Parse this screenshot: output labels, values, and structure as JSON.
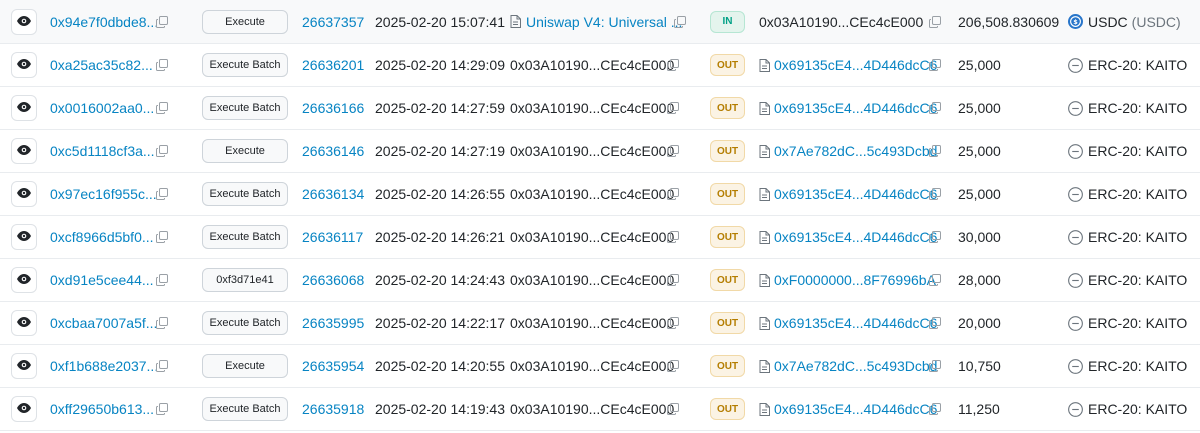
{
  "colors": {
    "link": "#0784c3",
    "in": "#00a186",
    "out": "#b47d00",
    "text": "#212529"
  },
  "rows": [
    {
      "hash": "0x94e7f0dbde8...",
      "method": "Execute",
      "block": "26637357",
      "age": "2025-02-20 15:07:41",
      "from": "Uniswap V4: Universal ...",
      "from_is_link": true,
      "direction": "IN",
      "to": "0x03A10190...CEc4cE000",
      "to_is_link": false,
      "amount": "206,508.830609",
      "token_name": "USDC",
      "token_symbol": "(USDC)",
      "token_icon": "usdc-icon"
    },
    {
      "hash": "0xa25ac35c82...",
      "method": "Execute Batch",
      "block": "26636201",
      "age": "2025-02-20 14:29:09",
      "from": "0x03A10190...CEc4cE000",
      "from_is_link": false,
      "direction": "OUT",
      "to": "0x69135cE4...4D446dcC6",
      "to_is_link": true,
      "amount": "25,000",
      "token_name": "ERC-20: KAITO",
      "token_symbol": "",
      "token_icon": "erc20-token-icon"
    },
    {
      "hash": "0x0016002aa0...",
      "method": "Execute Batch",
      "block": "26636166",
      "age": "2025-02-20 14:27:59",
      "from": "0x03A10190...CEc4cE000",
      "from_is_link": false,
      "direction": "OUT",
      "to": "0x69135cE4...4D446dcC6",
      "to_is_link": true,
      "amount": "25,000",
      "token_name": "ERC-20: KAITO",
      "token_symbol": "",
      "token_icon": "erc20-token-icon"
    },
    {
      "hash": "0xc5d1118cf3a...",
      "method": "Execute",
      "block": "26636146",
      "age": "2025-02-20 14:27:19",
      "from": "0x03A10190...CEc4cE000",
      "from_is_link": false,
      "direction": "OUT",
      "to": "0x7Ae782dC...5c493Dcbd",
      "to_is_link": true,
      "amount": "25,000",
      "token_name": "ERC-20: KAITO",
      "token_symbol": "",
      "token_icon": "erc20-token-icon"
    },
    {
      "hash": "0x97ec16f955c...",
      "method": "Execute Batch",
      "block": "26636134",
      "age": "2025-02-20 14:26:55",
      "from": "0x03A10190...CEc4cE000",
      "from_is_link": false,
      "direction": "OUT",
      "to": "0x69135cE4...4D446dcC6",
      "to_is_link": true,
      "amount": "25,000",
      "token_name": "ERC-20: KAITO",
      "token_symbol": "",
      "token_icon": "erc20-token-icon"
    },
    {
      "hash": "0xcf8966d5bf0...",
      "method": "Execute Batch",
      "block": "26636117",
      "age": "2025-02-20 14:26:21",
      "from": "0x03A10190...CEc4cE000",
      "from_is_link": false,
      "direction": "OUT",
      "to": "0x69135cE4...4D446dcC6",
      "to_is_link": true,
      "amount": "30,000",
      "token_name": "ERC-20: KAITO",
      "token_symbol": "",
      "token_icon": "erc20-token-icon"
    },
    {
      "hash": "0xd91e5cee44...",
      "method": "0xf3d71e41",
      "block": "26636068",
      "age": "2025-02-20 14:24:43",
      "from": "0x03A10190...CEc4cE000",
      "from_is_link": false,
      "direction": "OUT",
      "to": "0xF0000000...8F76996bA",
      "to_is_link": true,
      "amount": "28,000",
      "token_name": "ERC-20: KAITO",
      "token_symbol": "",
      "token_icon": "erc20-token-icon"
    },
    {
      "hash": "0xcbaa7007a5f...",
      "method": "Execute Batch",
      "block": "26635995",
      "age": "2025-02-20 14:22:17",
      "from": "0x03A10190...CEc4cE000",
      "from_is_link": false,
      "direction": "OUT",
      "to": "0x69135cE4...4D446dcC6",
      "to_is_link": true,
      "amount": "20,000",
      "token_name": "ERC-20: KAITO",
      "token_symbol": "",
      "token_icon": "erc20-token-icon"
    },
    {
      "hash": "0xf1b688e2037...",
      "method": "Execute",
      "block": "26635954",
      "age": "2025-02-20 14:20:55",
      "from": "0x03A10190...CEc4cE000",
      "from_is_link": false,
      "direction": "OUT",
      "to": "0x7Ae782dC...5c493Dcbd",
      "to_is_link": true,
      "amount": "10,750",
      "token_name": "ERC-20: KAITO",
      "token_symbol": "",
      "token_icon": "erc20-token-icon"
    },
    {
      "hash": "0xff29650b613...",
      "method": "Execute Batch",
      "block": "26635918",
      "age": "2025-02-20 14:19:43",
      "from": "0x03A10190...CEc4cE000",
      "from_is_link": false,
      "direction": "OUT",
      "to": "0x69135cE4...4D446dcC6",
      "to_is_link": true,
      "amount": "11,250",
      "token_name": "ERC-20: KAITO",
      "token_symbol": "",
      "token_icon": "erc20-token-icon"
    }
  ]
}
